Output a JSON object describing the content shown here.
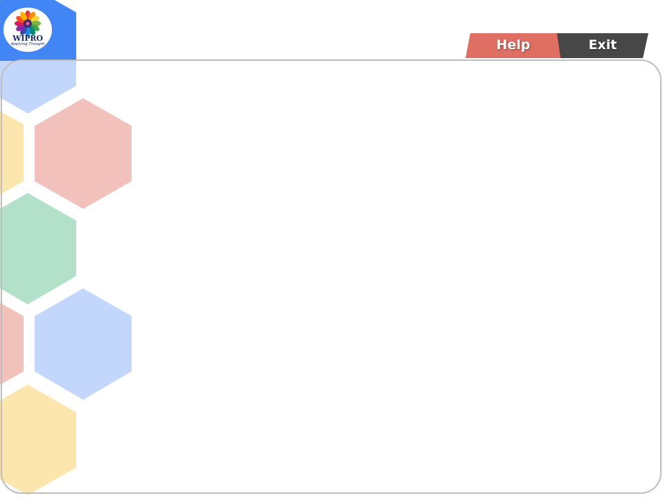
{
  "brand": {
    "name": "WIPRO",
    "tagline": "Applying Thought",
    "logo_icon": "wipro-flower-logo-icon"
  },
  "nav": {
    "help_label": "Help",
    "exit_label": "Exit"
  },
  "colors": {
    "help_tab": "#e06f63",
    "exit_tab": "#474747",
    "frame_border": "#bdbdbd",
    "hex_blue_strong": "#4285f4",
    "hex_blue_light": "#c3d6fb",
    "hex_red_light": "#f2c1bc",
    "hex_yellow_light": "#fde6ad",
    "hex_green_light": "#b3e0c9"
  }
}
